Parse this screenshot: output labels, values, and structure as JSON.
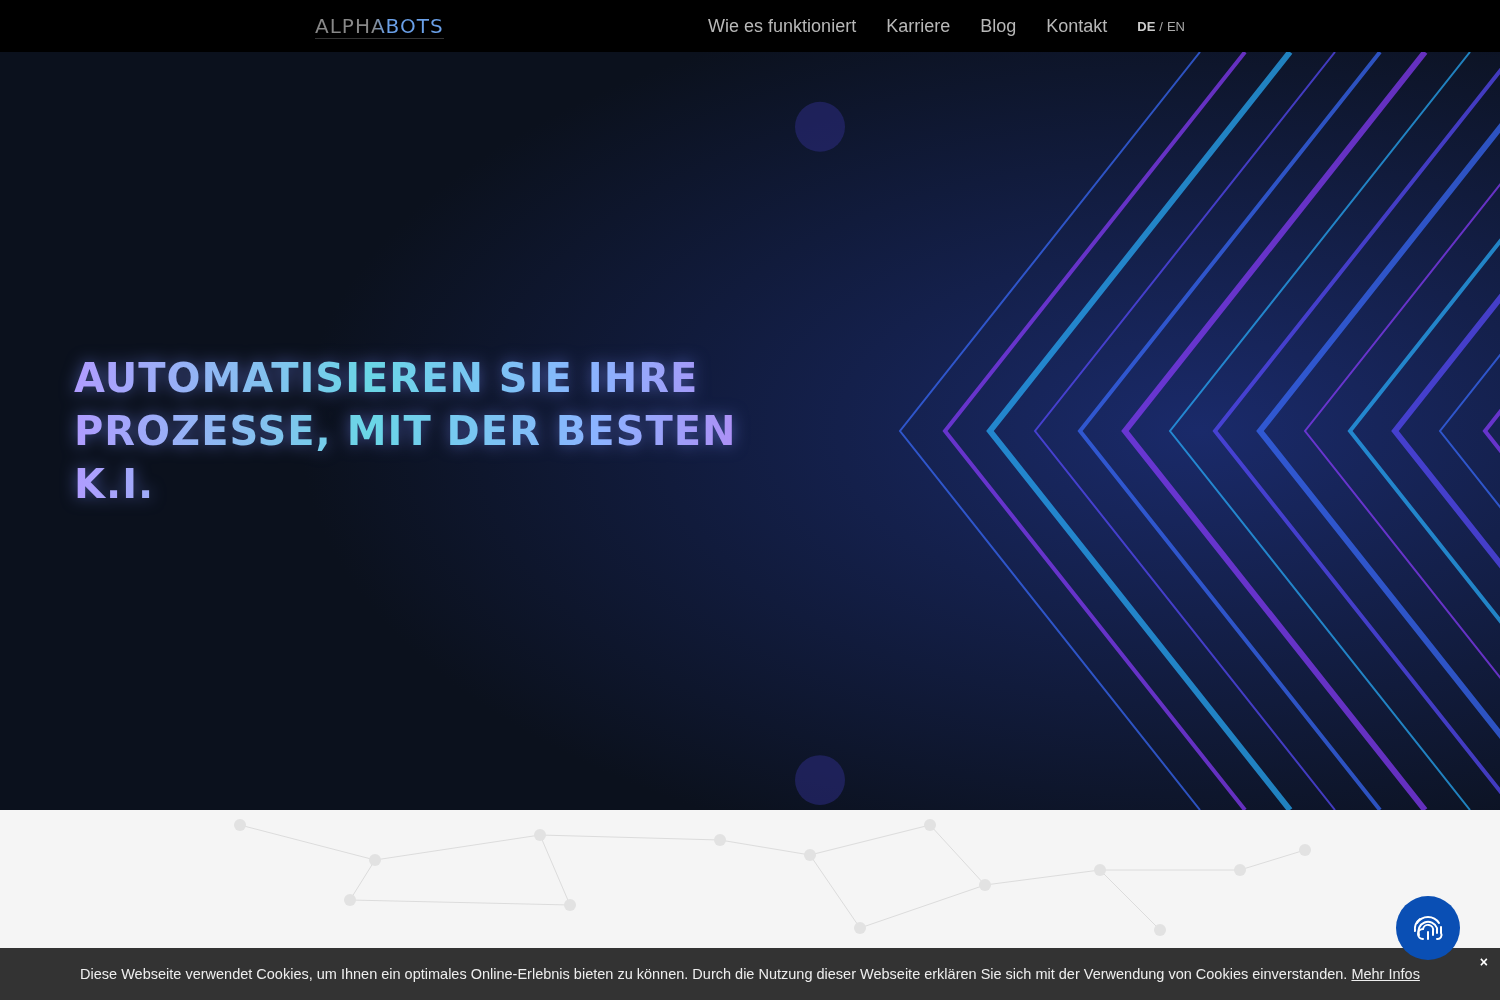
{
  "header": {
    "logo": "ALPHABOTS",
    "nav": [
      "Wie es funktioniert",
      "Karriere",
      "Blog",
      "Kontakt"
    ],
    "languages": [
      {
        "label": "DE",
        "selected": true
      },
      {
        "label": "EN",
        "selected": false
      }
    ],
    "language_separator": "/"
  },
  "hero": {
    "kind": "picture",
    "headline": "AUTOMATISIEREN SIE IHRE PROZESSE, MIT DER BESTEN K.I."
  },
  "cookie_banner": {
    "text": "Diese Webseite verwendet Cookies, um Ihnen ein optimales Online-Erlebnis bieten zu können. Durch die Nutzung dieser Webseite erklären Sie sich mit der Verwendung von Cookies einverstanden.",
    "link": "Mehr Infos",
    "close": "×"
  }
}
